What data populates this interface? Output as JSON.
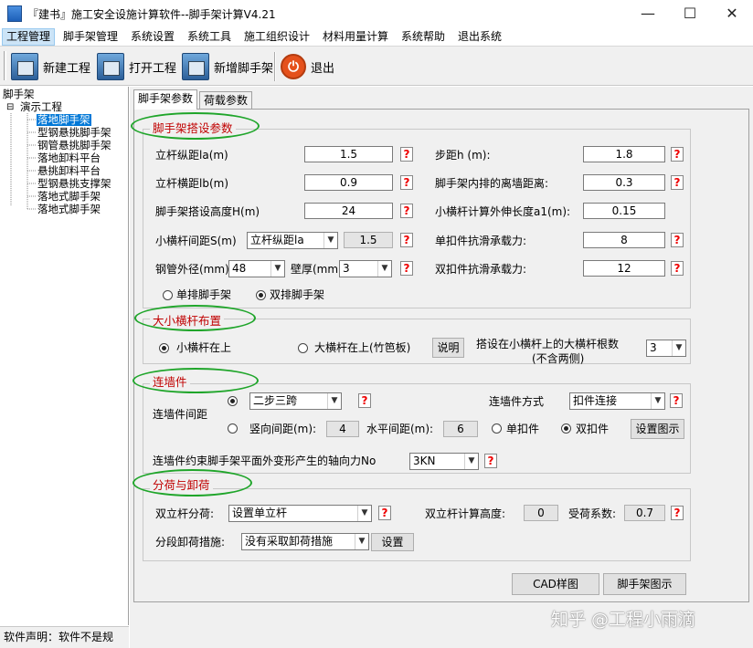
{
  "window": {
    "title": "『建书』施工安全设施计算软件--脚手架计算V4.21",
    "minimize": "—",
    "maximize": "☐",
    "close": "✕"
  },
  "menu": [
    "工程管理",
    "脚手架管理",
    "系统设置",
    "系统工具",
    "施工组织设计",
    "材料用量计算",
    "系统帮助",
    "退出系统"
  ],
  "toolbar": {
    "new_project": "新建工程",
    "open_project": "打开工程",
    "add_scaffold": "新增脚手架",
    "exit": "退出"
  },
  "tree": {
    "root": "脚手架",
    "project": "演示工程",
    "toggle": "⊟",
    "items": [
      "落地脚手架",
      "型钢悬挑脚手架",
      "钢管悬挑脚手架",
      "落地卸料平台",
      "悬挑卸料平台",
      "型钢悬挑支撑架",
      "落地式脚手架",
      "落地式脚手架"
    ],
    "selected_index": 0
  },
  "status": {
    "text": "软件声明：软件不是规"
  },
  "tabs": [
    "脚手架参数",
    "荷载参数"
  ],
  "help_glyph": "?",
  "sections": {
    "setup": {
      "title": "脚手架搭设参数",
      "la_label": "立杆纵距la(m)",
      "la_value": "1.5",
      "step_label": "步距h (m):",
      "step_value": "1.8",
      "lb_label": "立杆横距lb(m)",
      "lb_value": "0.9",
      "wall_dist_label": "脚手架内排的离墙距离:",
      "wall_dist_value": "0.3",
      "height_label": "脚手架搭设高度H(m)",
      "height_value": "24",
      "a1_label": "小横杆计算外伸长度a1(m):",
      "a1_value": "0.15",
      "spacing_label": "小横杆间距S(m)",
      "spacing_select": "立杆纵距la",
      "spacing_value": "1.5",
      "single_slip_label": "单扣件抗滑承载力:",
      "single_slip_value": "8",
      "pipe_od_label": "钢管外径(mm)",
      "pipe_od_value": "48",
      "wall_thick_label": "壁厚(mm)",
      "wall_thick_value": "3",
      "double_slip_label": "双扣件抗滑承载力:",
      "double_slip_value": "12",
      "single_row": "单排脚手架",
      "double_row": "双排脚手架",
      "row_selected": "double"
    },
    "bar_layout": {
      "title": "大小横杆布置",
      "small_on_top": "小横杆在上",
      "big_on_top": "大横杆在上(竹笆板)",
      "selected": "small",
      "explain_button": "说明",
      "count_label_1": "搭设在小横杆上的大横杆根数",
      "count_label_2": "(不含两侧)",
      "count_value": "3"
    },
    "wall_tie": {
      "title": "连墙件",
      "spacing_label": "连墙件间距",
      "preset_value": "二步三跨",
      "vertical_label": "竖向间距(m):",
      "vertical_value": "4",
      "horizontal_label": "水平间距(m):",
      "horizontal_value": "6",
      "method_label": "连墙件方式",
      "method_value": "扣件连接",
      "single_fastener": "单扣件",
      "double_fastener": "双扣件",
      "fastener_selected": "double",
      "diagram_button": "设置图示",
      "axial_label": "连墙件约束脚手架平面外变形产生的轴向力No",
      "axial_value": "3KN"
    },
    "load_split": {
      "title": "分荷与卸荷",
      "double_pole_label": "双立杆分荷:",
      "double_pole_value": "设置单立杆",
      "calc_height_label": "双立杆计算高度:",
      "calc_height_value": "0",
      "coef_label": "受荷系数:",
      "coef_value": "0.7",
      "unload_label": "分段卸荷措施:",
      "unload_value": "没有采取卸荷措施",
      "setup_button": "设置"
    }
  },
  "buttons": {
    "cad": "CAD样图",
    "diagram": "脚手架图示"
  },
  "watermark": "知乎 @工程小雨滴"
}
